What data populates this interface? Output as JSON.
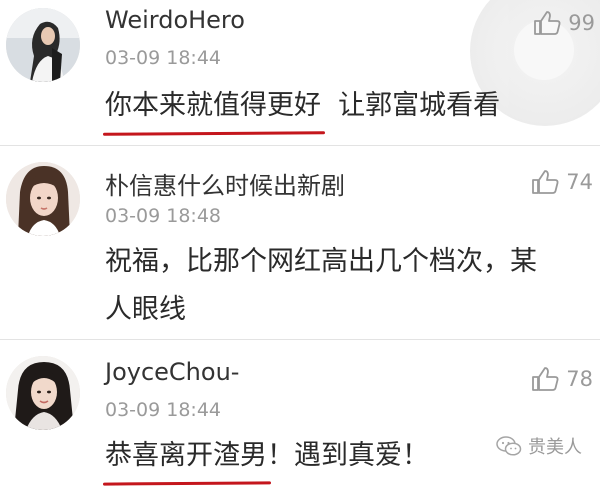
{
  "comments": [
    {
      "username": "WeirdoHero",
      "timestamp": "03-09 18:44",
      "text_highlight": "你本来就值得更好",
      "text_rest": "  让郭富城看看",
      "likes": "99"
    },
    {
      "username": "朴信惠什么时候出新剧",
      "timestamp": "03-09 18:48",
      "text_line1": "祝福，比那个网红高出几个档次，某",
      "text_line2": "人眼线",
      "likes": "74"
    },
    {
      "username": "JoyceChou-",
      "timestamp": "03-09 18:44",
      "text_highlight": "恭喜离开渣男",
      "text_rest": "！遇到真爱！",
      "likes": "78"
    }
  ],
  "watermark": "贵美人",
  "icons": {
    "like": "thumbs-up-icon",
    "watermark": "wechat-icon"
  },
  "colors": {
    "highlight_underline": "#c4161c",
    "muted_text": "#9a9a9a"
  }
}
